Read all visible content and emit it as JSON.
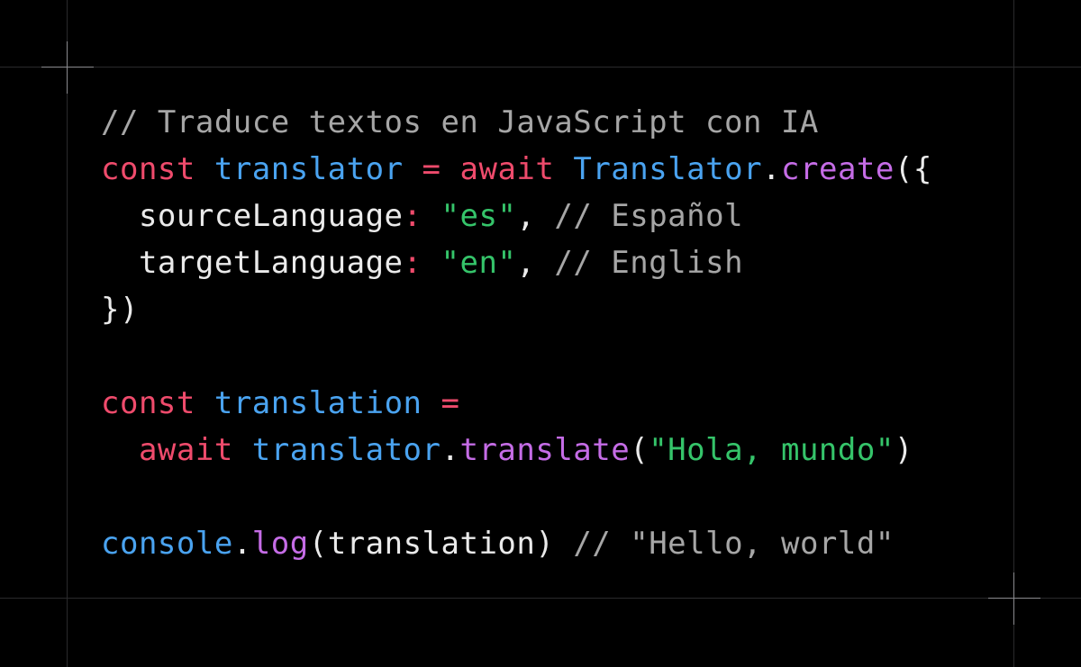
{
  "colors": {
    "background": "#000000",
    "comment": "#a6a6a6",
    "keyword": "#ef4b6c",
    "identifier": "#4aa3f0",
    "method": "#c56ce6",
    "string": "#35c46a",
    "text": "#eaeaea",
    "guide_line": "#2a2a2c",
    "corner_mark": "#8a8a8e"
  },
  "code": {
    "line1": {
      "comment": "// Traduce textos en JavaScript con IA"
    },
    "line2": {
      "kw": "const",
      "sp1": " ",
      "ident": "translator",
      "sp2": " ",
      "eq": "=",
      "sp3": " ",
      "kw2": "await",
      "sp4": " ",
      "cls": "Translator",
      "dot": ".",
      "method": "create",
      "open": "({"
    },
    "line3": {
      "indent": "  ",
      "prop": "sourceLanguage",
      "colon": ":",
      "sp": " ",
      "str": "\"es\"",
      "comma": ",",
      "sp2": " ",
      "comment": "// Español"
    },
    "line4": {
      "indent": "  ",
      "prop": "targetLanguage",
      "colon": ":",
      "sp": " ",
      "str": "\"en\"",
      "comma": ",",
      "sp2": " ",
      "comment": "// English"
    },
    "line5": {
      "close": "})"
    },
    "line7": {
      "kw": "const",
      "sp1": " ",
      "ident": "translation",
      "sp2": " ",
      "eq": "="
    },
    "line8": {
      "indent": "  ",
      "kw": "await",
      "sp1": " ",
      "ident": "translator",
      "dot": ".",
      "method": "translate",
      "open": "(",
      "str": "\"Hola, mundo\"",
      "close": ")"
    },
    "line10": {
      "ident": "console",
      "dot": ".",
      "method": "log",
      "open": "(",
      "arg": "translation",
      "close": ")",
      "sp": " ",
      "comment": "// \"Hello, world\""
    }
  }
}
